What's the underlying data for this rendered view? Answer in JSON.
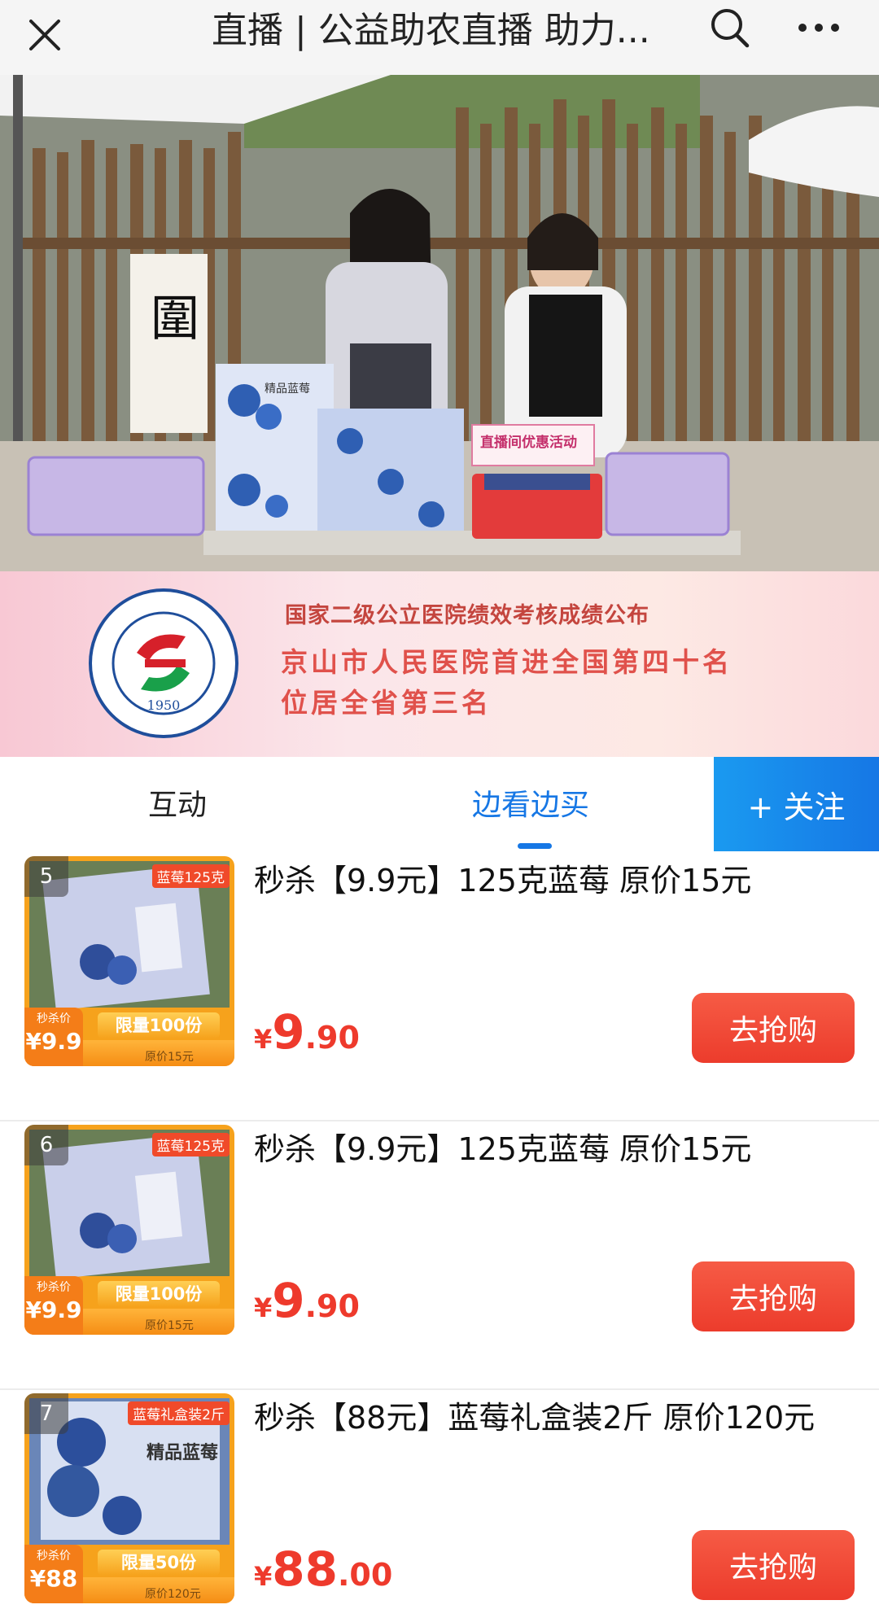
{
  "header": {
    "title": "直播 | 公益助农直播 助力..."
  },
  "video": {
    "basket_sign": "直播间优惠活动",
    "box_label": "精品蓝莓"
  },
  "banner": {
    "line1": "国家二级公立医院绩效考核成绩公布",
    "line2": "京山市人民医院首进全国第四十名",
    "line3": "位居全省第三名",
    "logo_year": "1950",
    "logo_ring_text": "PEOPLE'S HOSPITAL OF JING SHAN"
  },
  "tabs": {
    "interact": "互动",
    "shop": "边看边买",
    "follow": "+ 关注"
  },
  "products": [
    {
      "index": "5",
      "name": "秒杀【9.9元】125克蓝莓 原价15元",
      "price_currency": "¥",
      "price_int": "9",
      "price_dec": ".90",
      "buy_label": "去抢购",
      "thumb_tag": "蓝莓125克",
      "thumb_limit": "限量100份",
      "thumb_seckill_label": "秒杀价",
      "thumb_seckill_price": "¥9.9",
      "thumb_orig": "原价15元"
    },
    {
      "index": "6",
      "name": "秒杀【9.9元】125克蓝莓 原价15元",
      "price_currency": "¥",
      "price_int": "9",
      "price_dec": ".90",
      "buy_label": "去抢购",
      "thumb_tag": "蓝莓125克",
      "thumb_limit": "限量100份",
      "thumb_seckill_label": "秒杀价",
      "thumb_seckill_price": "¥9.9",
      "thumb_orig": "原价15元"
    },
    {
      "index": "7",
      "name": "秒杀【88元】蓝莓礼盒装2斤 原价120元",
      "price_currency": "¥",
      "price_int": "88",
      "price_dec": ".00",
      "buy_label": "去抢购",
      "thumb_tag": "蓝莓礼盒装2斤",
      "thumb_limit": "限量50份",
      "thumb_seckill_label": "秒杀价",
      "thumb_seckill_price": "¥88",
      "thumb_orig": "原价120元"
    }
  ]
}
